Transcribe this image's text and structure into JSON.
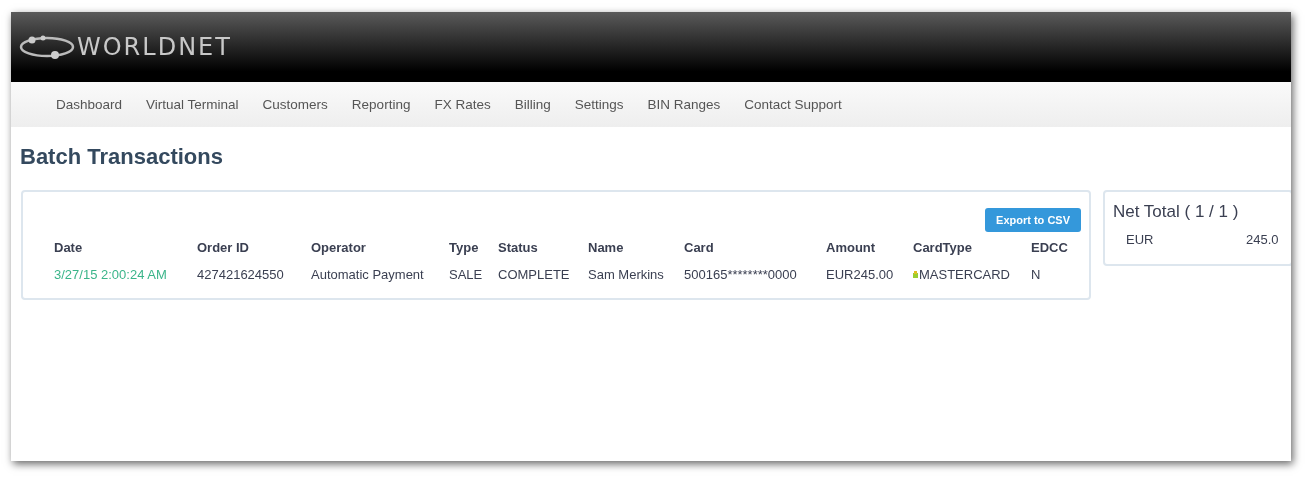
{
  "header": {
    "logo": "WORLDNET"
  },
  "nav": [
    "Dashboard",
    "Virtual Terminal",
    "Customers",
    "Reporting",
    "FX Rates",
    "Billing",
    "Settings",
    "BIN Ranges",
    "Contact Support"
  ],
  "page_title": "Batch Transactions",
  "transactions": {
    "export_button": "Export to CSV",
    "columns": [
      "Date",
      "Order ID",
      "Operator",
      "Type",
      "Status",
      "Name",
      "Card",
      "Amount",
      "CardType",
      "EDCC"
    ],
    "rows": [
      [
        {
          "kind": "link",
          "text": "3/27/15 2:00:24 AM"
        },
        {
          "kind": "text",
          "text": "427421624550"
        },
        {
          "kind": "text",
          "text": "Automatic Payment"
        },
        {
          "kind": "text",
          "text": "SALE"
        },
        {
          "kind": "text",
          "text": "COMPLETE"
        },
        {
          "kind": "text",
          "text": "Sam Merkins"
        },
        {
          "kind": "text",
          "text": "500165********0000"
        },
        {
          "kind": "text",
          "text": "EUR245.00"
        },
        {
          "kind": "card",
          "text": "MASTERCARD"
        },
        {
          "kind": "text",
          "text": "N"
        }
      ]
    ]
  },
  "net_total": {
    "title": "Net Total ( 1 / 1 )",
    "rows": [
      {
        "currency": "EUR",
        "amount": "245.0"
      }
    ]
  }
}
